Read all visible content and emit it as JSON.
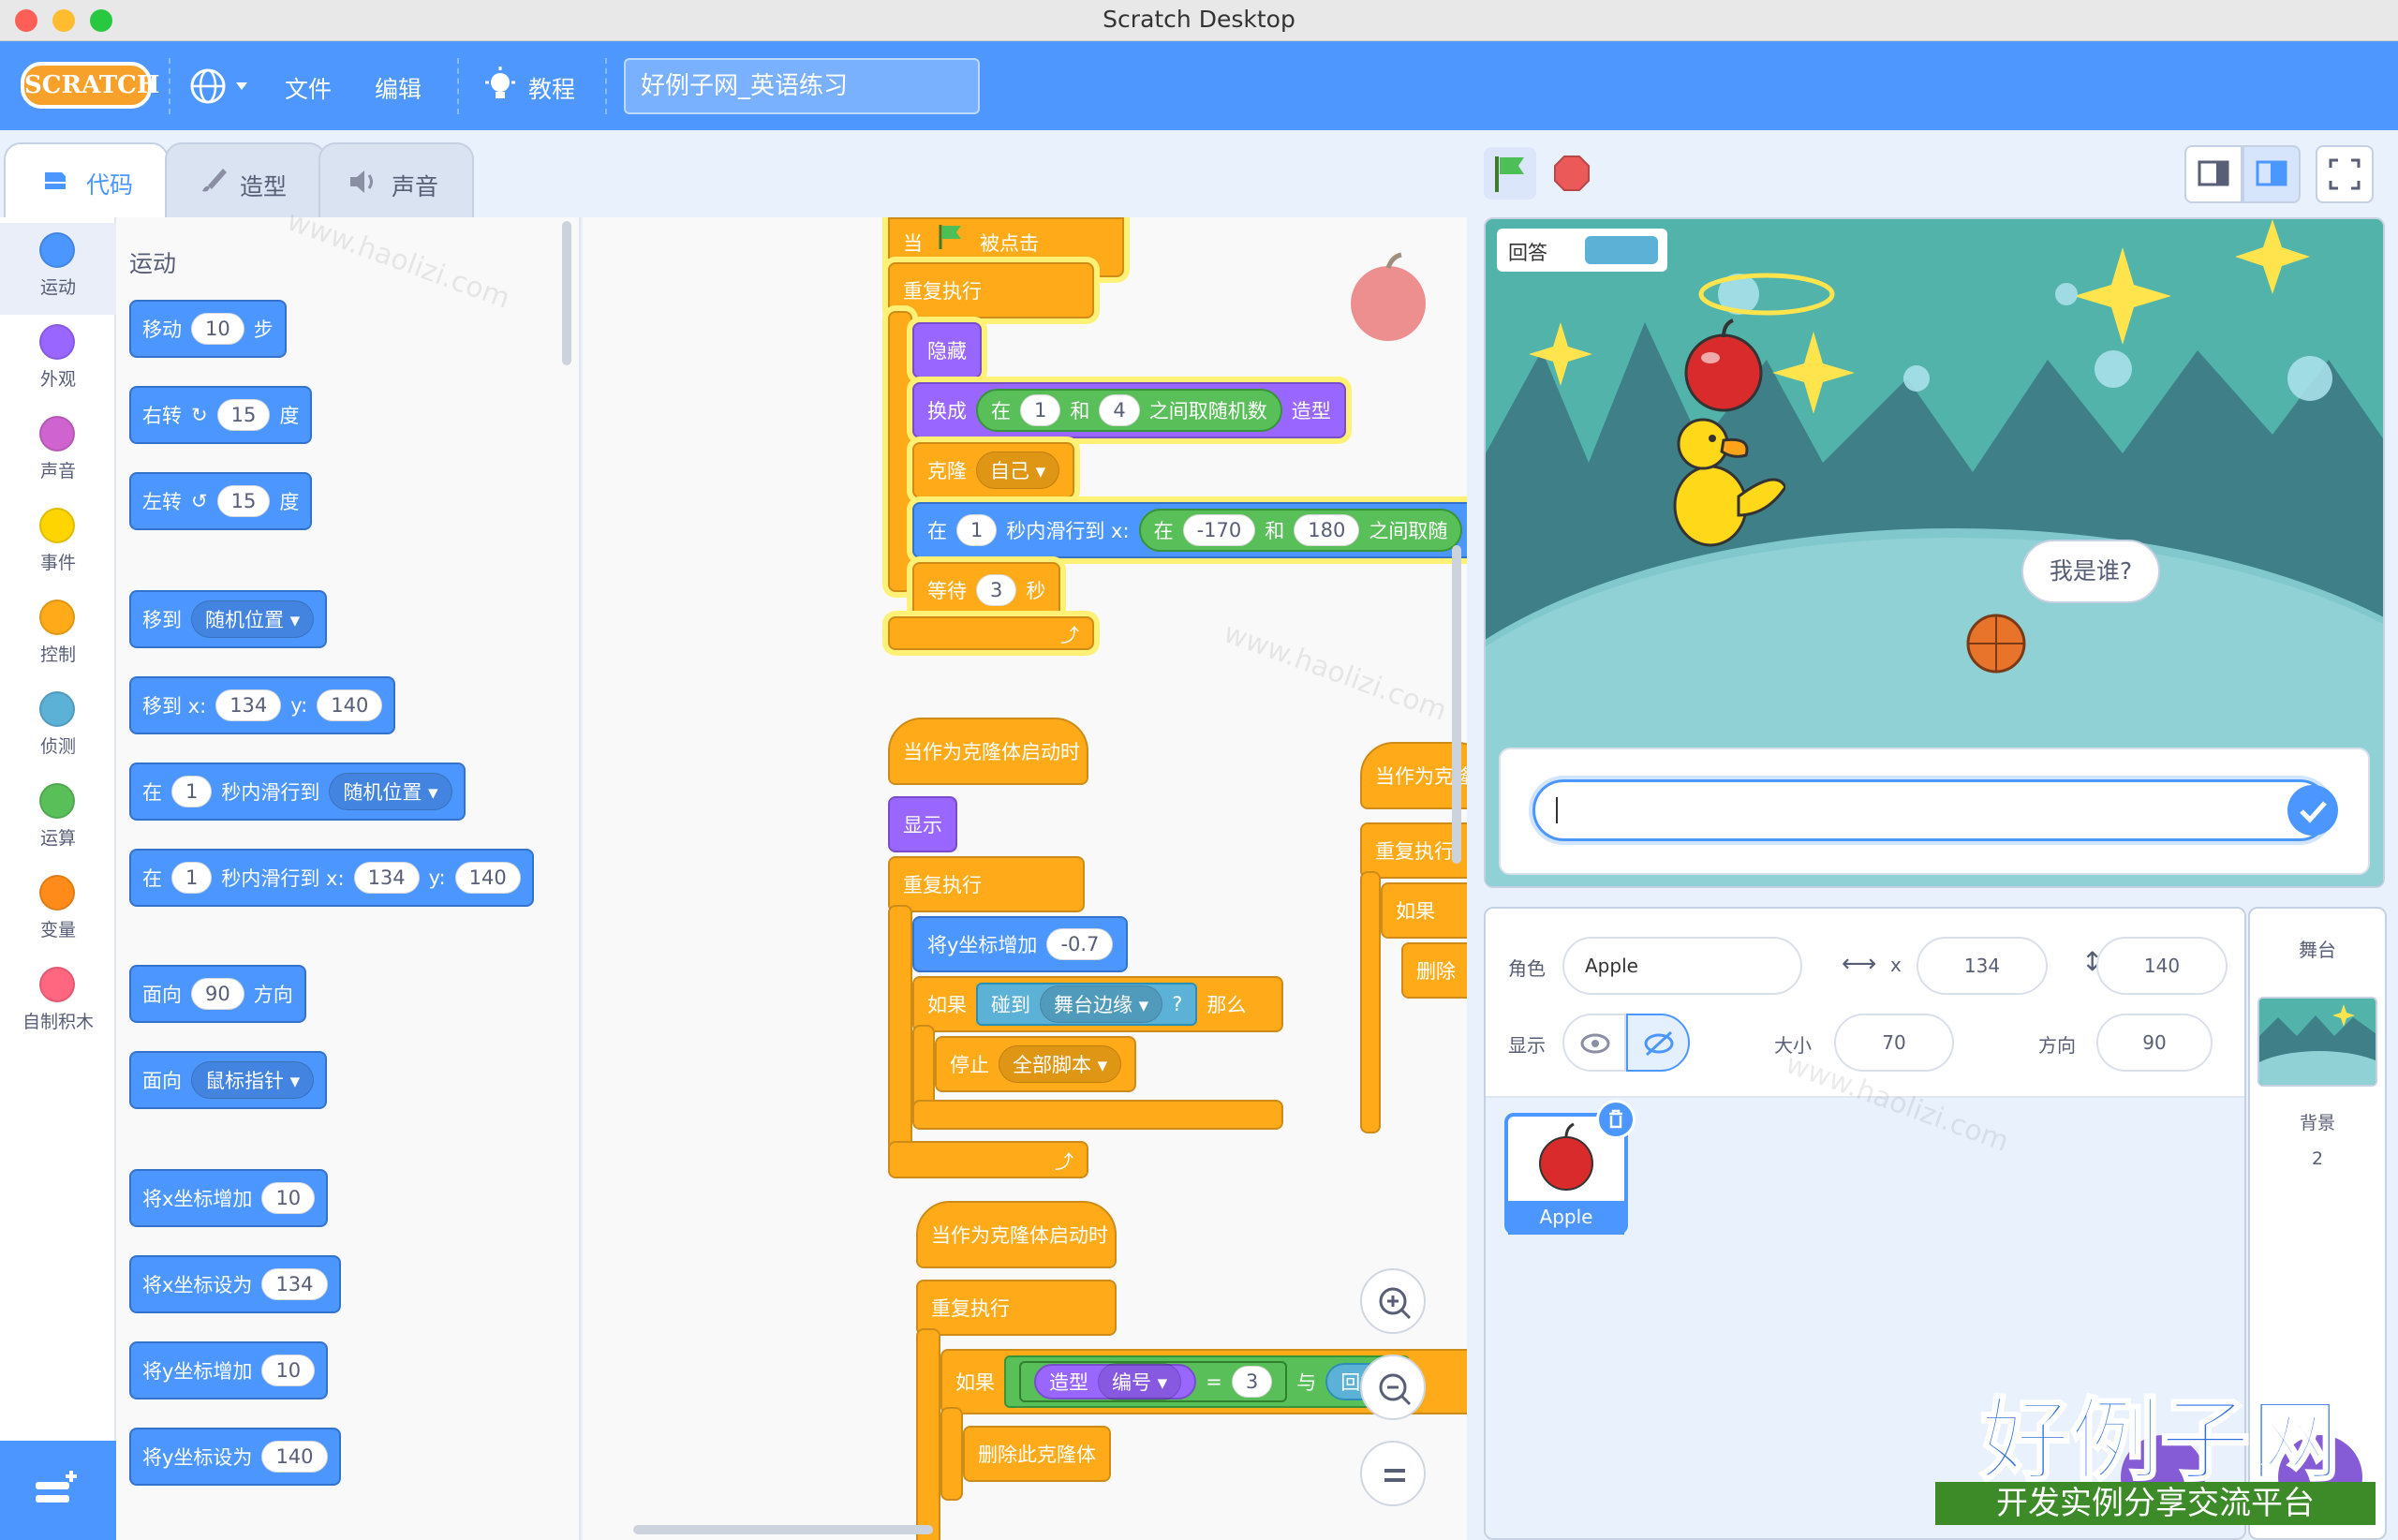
{
  "window": {
    "title": "Scratch Desktop"
  },
  "menubar": {
    "logo": "SCRATCH",
    "file": "文件",
    "edit": "编辑",
    "tutorials": "教程",
    "project_title": "好例子网_英语练习"
  },
  "tabs": {
    "code": "代码",
    "costumes": "造型",
    "sounds": "声音"
  },
  "categories": [
    {
      "label": "运动",
      "color": "#4c97ff"
    },
    {
      "label": "外观",
      "color": "#9966ff"
    },
    {
      "label": "声音",
      "color": "#cf63cf"
    },
    {
      "label": "事件",
      "color": "#ffd500"
    },
    {
      "label": "控制",
      "color": "#ffab19"
    },
    {
      "label": "侦测",
      "color": "#5cb1d6"
    },
    {
      "label": "运算",
      "color": "#59c059"
    },
    {
      "label": "变量",
      "color": "#ff8c1a"
    },
    {
      "label": "自制积木",
      "color": "#ff6680"
    }
  ],
  "palette": {
    "heading": "运动",
    "move": {
      "a": "移动",
      "v": "10",
      "b": "步"
    },
    "turn_right": {
      "a": "右转",
      "v": "15",
      "b": "度"
    },
    "turn_left": {
      "a": "左转",
      "v": "15",
      "b": "度"
    },
    "goto": {
      "a": "移到",
      "d": "随机位置"
    },
    "goto_xy": {
      "a": "移到 x:",
      "x": "134",
      "y_label": "y:",
      "y": "140"
    },
    "glide": {
      "a": "在",
      "v": "1",
      "b": "秒内滑行到",
      "d": "随机位置"
    },
    "glide_xy": {
      "a": "在",
      "v": "1",
      "b": "秒内滑行到 x:",
      "x": "134",
      "y_label": "y:",
      "y": "140"
    },
    "point_dir": {
      "a": "面向",
      "v": "90",
      "b": "方向"
    },
    "point_towards": {
      "a": "面向",
      "d": "鼠标指针"
    },
    "change_x": {
      "a": "将x坐标增加",
      "v": "10"
    },
    "set_x": {
      "a": "将x坐标设为",
      "v": "134"
    },
    "change_y": {
      "a": "将y坐标增加",
      "v": "10"
    },
    "set_y": {
      "a": "将y坐标设为",
      "v": "140"
    }
  },
  "script1": {
    "hat_a": "当",
    "hat_b": "被点击",
    "forever": "重复执行",
    "hide": "隐藏",
    "switch_a": "换成",
    "in": "在",
    "r1": "1",
    "and": "和",
    "r2": "4",
    "rand": "之间取随机数",
    "costume": "造型",
    "clone": "克隆",
    "myself": "自己",
    "glide_a": "在",
    "glide_v": "1",
    "glide_b": "秒内滑行到 x:",
    "g_in": "在",
    "gx1": "-170",
    "g_and": "和",
    "gx2": "180",
    "g_rand": "之间取随",
    "wait": "等待",
    "wait_v": "3",
    "sec": "秒"
  },
  "script2": {
    "hat": "当作为克隆体启动时",
    "show": "显示",
    "forever": "重复执行",
    "change_y": "将y坐标增加",
    "dy": "-0.7",
    "if": "如果",
    "touch": "碰到",
    "edge": "舞台边缘",
    "q": "?",
    "then": "那么",
    "stop": "停止",
    "all": "全部脚本"
  },
  "script3": {
    "hat": "当作为克隆体启动时",
    "forever": "重复执行",
    "if": "如果",
    "costume": "造型",
    "number": "编号",
    "eq": "=",
    "val": "3",
    "and": "与",
    "answer": "回答",
    "delete": "删除此克隆体"
  },
  "script4": {
    "hat": "当作为克隆",
    "forever": "重复执行",
    "if": "如果",
    "delete": "删除"
  },
  "stage": {
    "answer_label": "回答",
    "speech": "我是谁?",
    "input_value": ""
  },
  "sprite_info": {
    "sprite_label": "角色",
    "name": "Apple",
    "x_label": "x",
    "x": "134",
    "y_label": "y",
    "y": "140",
    "show_label": "显示",
    "size_label": "大小",
    "size": "70",
    "dir_label": "方向",
    "dir": "90"
  },
  "sprites": [
    {
      "name": "Apple"
    }
  ],
  "stage_panel": {
    "title": "舞台",
    "backdrop_label": "背景",
    "backdrop_count": "2"
  },
  "watermark": {
    "big": "好例子网",
    "small": "开发实例分享交流平台",
    "repeat": "www.haolizi.com"
  },
  "colors": {
    "menu": "#4d97ff",
    "motion": "#4c97ff",
    "control": "#ffab19",
    "looks": "#9966ff",
    "operators": "#59c059",
    "sensing": "#5cb1d6",
    "events": "#ffbf00"
  }
}
